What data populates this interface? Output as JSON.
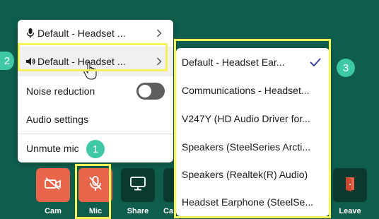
{
  "menu": {
    "items": [
      {
        "label": "Default - Headset ...",
        "icon": "microphone-icon"
      },
      {
        "label": "Default - Headset ...",
        "icon": "speaker-icon"
      },
      {
        "label": "Noise reduction",
        "toggle": false
      },
      {
        "label": "Audio settings"
      },
      {
        "label": "Unmute mic"
      }
    ]
  },
  "submenu": {
    "items": [
      {
        "label": "Default - Headset Ear...",
        "selected": true
      },
      {
        "label": "Communications - Headset..."
      },
      {
        "label": "V247Y (HD Audio Driver for..."
      },
      {
        "label": "Speakers (SteelSeries Arcti..."
      },
      {
        "label": "Speakers (Realtek(R) Audio)"
      },
      {
        "label": "Headset Earphone (SteelSe..."
      }
    ]
  },
  "badges": [
    "1",
    "2",
    "3"
  ],
  "toolbar": {
    "cam": "Cam",
    "mic": "Mic",
    "share": "Share",
    "cal": "Ca",
    "leave": "Leave"
  },
  "colors": {
    "background": "#0f5e4c",
    "danger": "#e8644a",
    "dark_button": "#0a3a2e",
    "highlight": "#f4f35a",
    "badge": "#3ec9a4",
    "check": "#3b3fa8"
  }
}
